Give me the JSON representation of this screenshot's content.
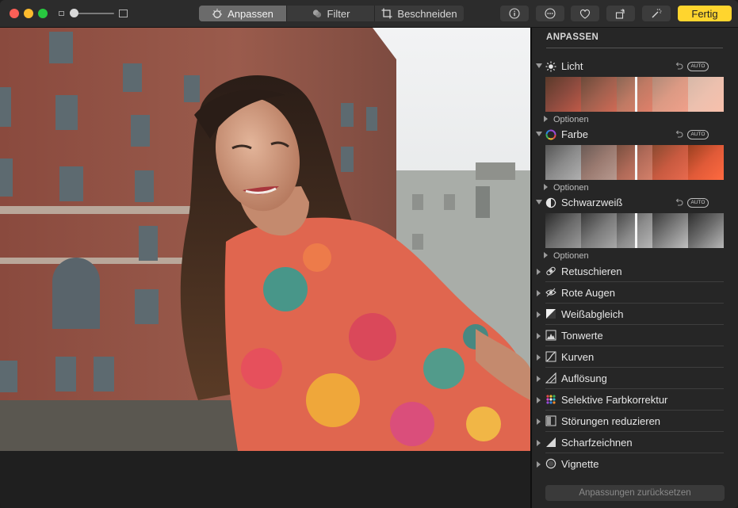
{
  "toolbar": {
    "tabs": [
      {
        "label": "Anpassen",
        "active": true
      },
      {
        "label": "Filter",
        "active": false
      },
      {
        "label": "Beschneiden",
        "active": false
      }
    ],
    "done_label": "Fertig",
    "icons": [
      "info-icon",
      "more-icon",
      "heart-icon",
      "rotate-icon",
      "magic-wand-icon"
    ],
    "accent": "#ffd52e"
  },
  "sidebar": {
    "title": "ANPASSEN",
    "sections": [
      {
        "label": "Licht",
        "auto": "AUTO",
        "options_label": "Optionen",
        "icon": "sun-icon"
      },
      {
        "label": "Farbe",
        "auto": "AUTO",
        "options_label": "Optionen",
        "icon": "color-wheel-icon"
      },
      {
        "label": "Schwarzweiß",
        "auto": "AUTO",
        "options_label": "Optionen",
        "icon": "half-circle-icon"
      }
    ],
    "rows": [
      {
        "label": "Retuschieren",
        "icon": "bandage-icon"
      },
      {
        "label": "Rote Augen",
        "icon": "eye-icon"
      },
      {
        "label": "Weißabgleich",
        "icon": "white-balance-icon"
      },
      {
        "label": "Tonwerte",
        "icon": "levels-icon"
      },
      {
        "label": "Kurven",
        "icon": "curves-icon"
      },
      {
        "label": "Auflösung",
        "icon": "definition-icon"
      },
      {
        "label": "Selektive Farbkorrektur",
        "icon": "selective-color-icon"
      },
      {
        "label": "Störungen reduzieren",
        "icon": "noise-icon"
      },
      {
        "label": "Scharfzeichnen",
        "icon": "sharpen-icon"
      },
      {
        "label": "Vignette",
        "icon": "vignette-icon"
      }
    ],
    "reset_label": "Anpassungen zurücksetzen"
  }
}
